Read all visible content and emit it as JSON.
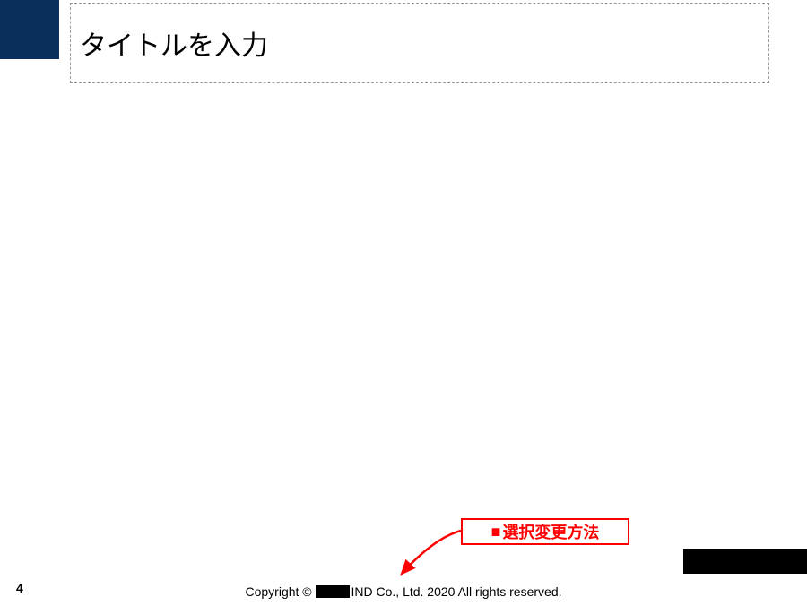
{
  "header": {
    "title_placeholder": "タイトルを入力"
  },
  "callout": {
    "marker": "■",
    "label": "選択変更方法"
  },
  "footer": {
    "page_number": "4",
    "copyright_prefix": "Copyright © ",
    "copyright_suffix": "IND Co., Ltd. 2020 All rights reserved."
  }
}
